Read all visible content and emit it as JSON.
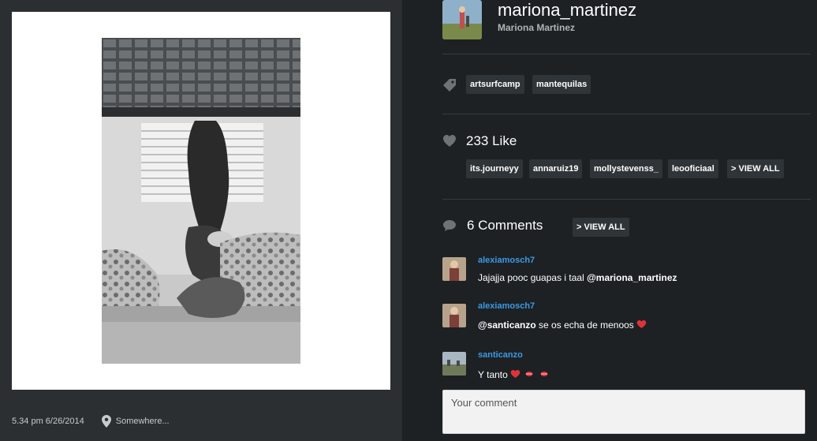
{
  "post": {
    "timestamp": "5.34 pm 6/26/2014",
    "location": "Somewhere..."
  },
  "profile": {
    "username": "mariona_martinez",
    "full_name": "Mariona Martinez"
  },
  "tags": [
    "artsurfcamp",
    "mantequilas"
  ],
  "likes": {
    "count_label": "233 Like",
    "users": [
      "its.journeyy",
      "annaruiz19",
      "mollystevenss_",
      "leooficiaal"
    ],
    "view_all_label": "> VIEW ALL"
  },
  "comments": {
    "count_label": "6 Comments",
    "view_all_label": "> VIEW ALL",
    "items": [
      {
        "user": "alexiamosch7",
        "text": "Jajajja pooc guapas i taal ",
        "mention": "@mariona_martinez",
        "after": ""
      },
      {
        "user": "alexiamosch7",
        "text": "",
        "mention": "@santicanzo",
        "after": " se os echa de menoos"
      },
      {
        "user": "santicanzo",
        "text": "Y tanto",
        "mention": "",
        "after": ""
      }
    ]
  },
  "comment_input": {
    "placeholder": "Your comment"
  },
  "colors": {
    "link_blue": "#3b99e5",
    "heart_red": "#e0323c",
    "panel": "#2b2f32",
    "background": "#1d2123"
  }
}
